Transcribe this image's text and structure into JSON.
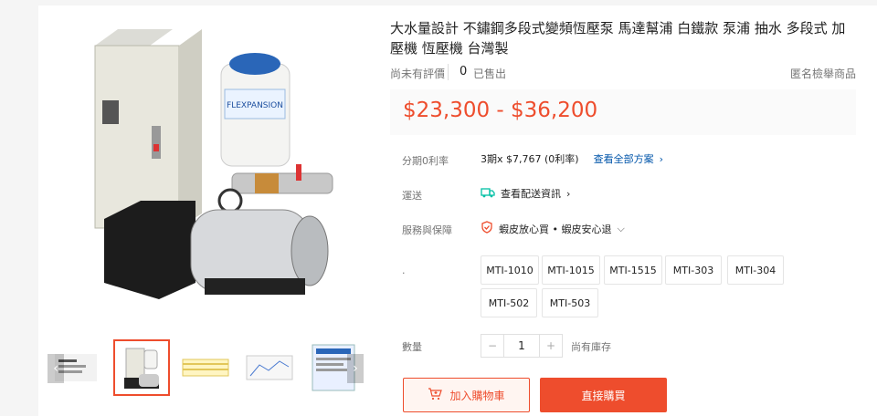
{
  "product": {
    "title": "大水量設計 不鏽鋼多段式變頻恆壓泵 馬達幫浦 白鐵款 泵浦 抽水 多段式 加壓機 恆壓機 台灣製",
    "rating_text": "尚未有評價",
    "sold_count": "0",
    "sold_label": "已售出",
    "report_label": "匿名檢舉商品",
    "price": "$23,300 - $36,200",
    "image_label": "FLEXPANSION"
  },
  "installment": {
    "label": "分期0利率",
    "value": "3期x $7,767 (0利率)",
    "link": "查看全部方案"
  },
  "shipping": {
    "label": "運送",
    "value": "查看配送資訊"
  },
  "guarantee": {
    "label": "服務與保障",
    "value": "蝦皮放心買 • 蝦皮安心退"
  },
  "variations": {
    "label": ".",
    "options": [
      "MTI-1010",
      "MTI-1015",
      "MTI-1515",
      "MTI-303",
      "MTI-304",
      "MTI-502",
      "MTI-503"
    ]
  },
  "quantity": {
    "label": "數量",
    "value": "1",
    "minus": "−",
    "plus": "+",
    "stock": "尚有庫存"
  },
  "actions": {
    "add_to_cart": "加入購物車",
    "buy_now": "直接購買"
  },
  "gallery": {
    "prev": "‹",
    "next": "›"
  },
  "colors": {
    "accent": "#ee4d2d"
  }
}
